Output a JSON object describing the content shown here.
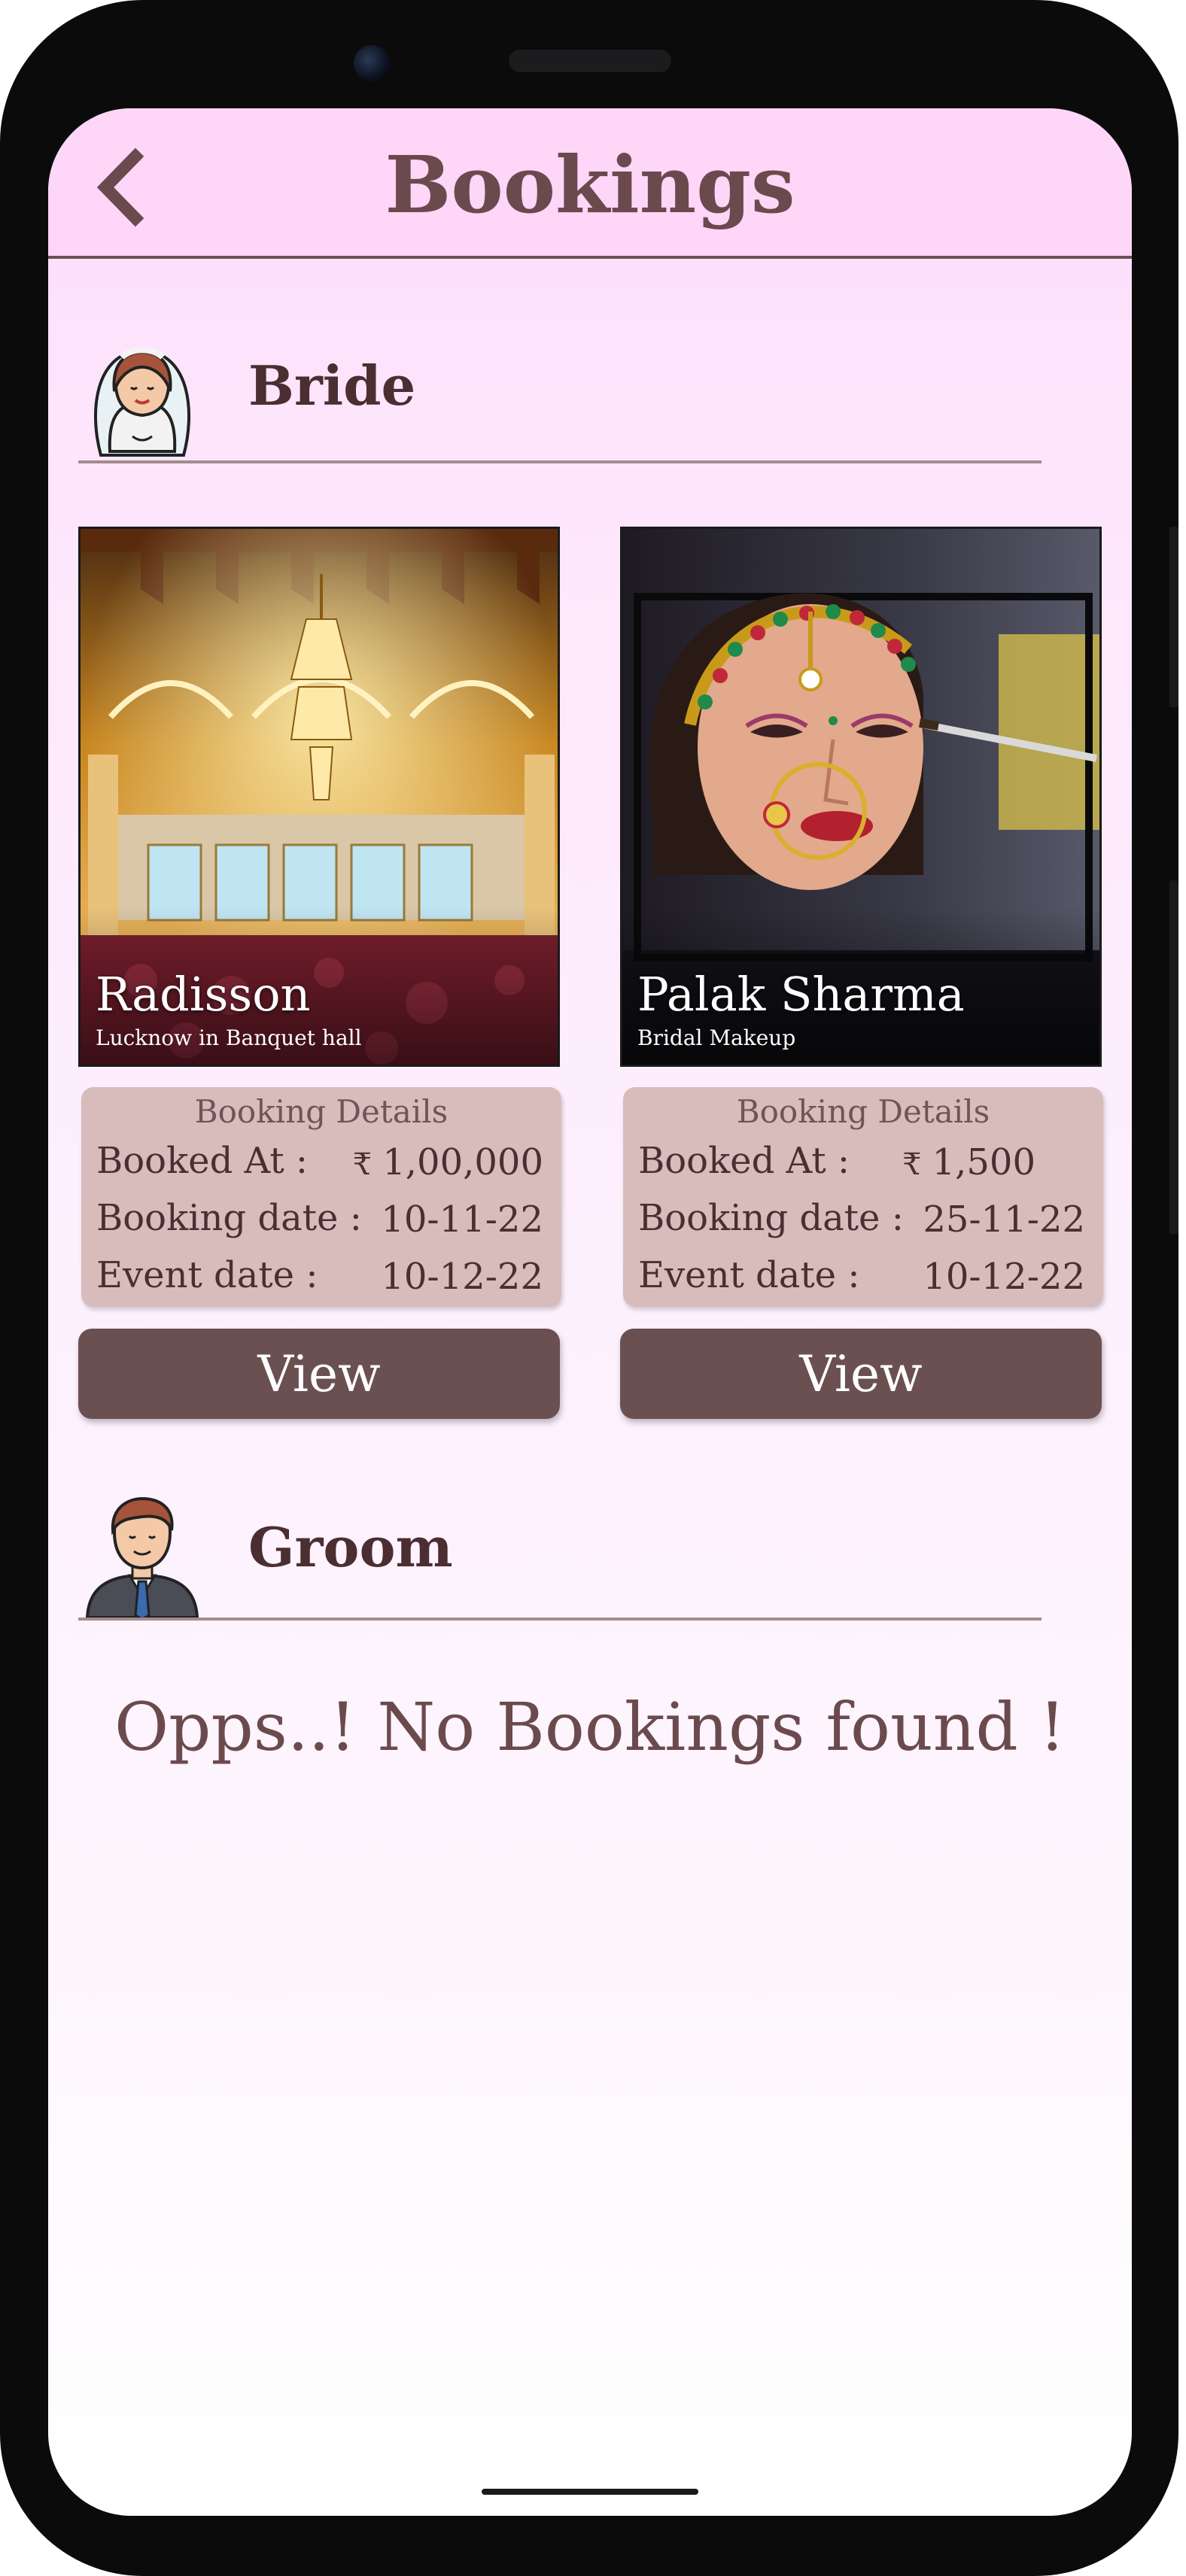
{
  "header": {
    "title": "Bookings"
  },
  "sections": [
    {
      "label": "Bride",
      "cards": [
        {
          "name": "Radisson",
          "subtitle": "Lucknow in Banquet hall",
          "details_title": "Booking Details",
          "rows": [
            {
              "label": "Booked At :",
              "currency": "₹",
              "value": "1,00,000"
            },
            {
              "label": "Booking date :",
              "value": "10-11-22"
            },
            {
              "label": "Event date :",
              "value": "10-12-22"
            }
          ],
          "button": "View"
        },
        {
          "name": "Palak Sharma",
          "subtitle": "Bridal Makeup",
          "details_title": "Booking Details",
          "rows": [
            {
              "label": "Booked At :",
              "currency": "₹",
              "value": "1,500"
            },
            {
              "label": "Booking date :",
              "value": "25-11-22"
            },
            {
              "label": "Event date :",
              "value": "10-12-22"
            }
          ],
          "button": "View"
        }
      ]
    },
    {
      "label": "Groom",
      "empty_message": "Opps..! No Bookings found !"
    }
  ],
  "colors": {
    "header_bg": "#fdd6f8",
    "accent": "#6b5052",
    "details_bg": "#d8bcbb",
    "text_dark": "#4a2e31"
  }
}
